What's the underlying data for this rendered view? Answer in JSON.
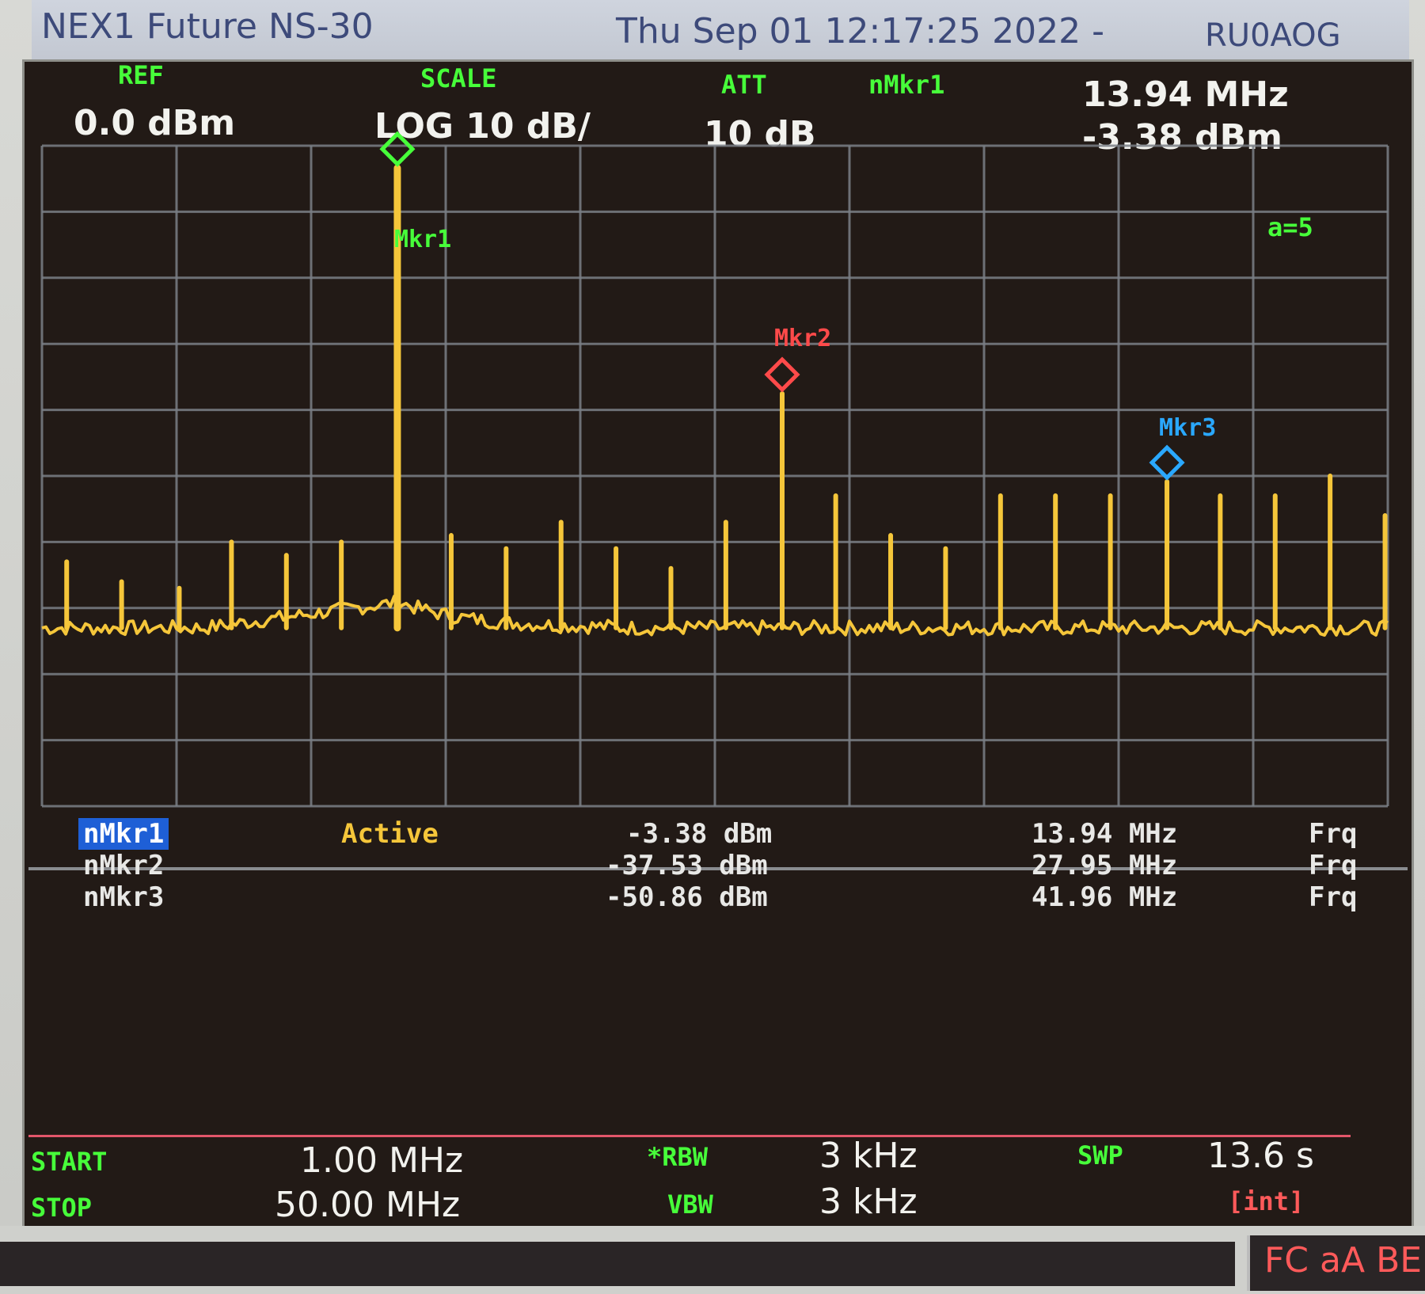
{
  "title_bar": {
    "device": "NEX1 Future NS-30",
    "datetime": "Thu Sep 01 12:17:25 2022 -",
    "callsign": "RU0AOG"
  },
  "header": {
    "ref_label": "REF",
    "ref_value": "0.0 dBm",
    "scale_label": "SCALE",
    "scale_value": "LOG 10 dB/",
    "att_label": "ATT",
    "att_value": "10 dB",
    "active_marker_label": "nMkr1",
    "active_marker_freq": "13.94 MHz",
    "active_marker_level": "-3.38 dBm",
    "avg_indicator": "a=5"
  },
  "markers_on_trace": [
    {
      "label": "Mkr1",
      "color": "#47ff3a"
    },
    {
      "label": "Mkr2",
      "color": "#ff4a4a"
    },
    {
      "label": "Mkr3",
      "color": "#2aa8ff"
    }
  ],
  "marker_table": [
    {
      "name": "nMkr1",
      "status": "Active",
      "level": "-3.38 dBm",
      "freq": "13.94 MHz",
      "mode": "Frq"
    },
    {
      "name": "nMkr2",
      "status": "",
      "level": "-37.53 dBm",
      "freq": "27.95 MHz",
      "mode": "Frq"
    },
    {
      "name": "nMkr3",
      "status": "",
      "level": "-50.86 dBm",
      "freq": "41.96 MHz",
      "mode": "Frq"
    }
  ],
  "footer": {
    "start_label": "START",
    "start_value": "1.00 MHz",
    "stop_label": "STOP",
    "stop_value": "50.00 MHz",
    "rbw_label": "*RBW",
    "rbw_value": "3 kHz",
    "vbw_label": "VBW",
    "vbw_value": "3 kHz",
    "swp_label": "SWP",
    "swp_value": "13.6 s",
    "swp_mode": "[int]"
  },
  "status_box": "FC aA BE",
  "colors": {
    "trace": "#f5c63a",
    "grid": "#7b7f86",
    "label_green": "#47ff3a",
    "mkr2": "#ff4a4a",
    "mkr3": "#2aa8ff",
    "background": "#221a16"
  },
  "chart_data": {
    "type": "line",
    "xlim": [
      1.0,
      50.0
    ],
    "ylim": [
      -100,
      0
    ],
    "noise_floor_dbm": -73,
    "peaks": [
      {
        "x": 13.94,
        "y": -3.38
      },
      {
        "x": 27.95,
        "y": -37.53
      },
      {
        "x": 41.96,
        "y": -50.86
      },
      {
        "x": 1.9,
        "y": -63
      },
      {
        "x": 3.9,
        "y": -66
      },
      {
        "x": 6.0,
        "y": -67
      },
      {
        "x": 7.9,
        "y": -60
      },
      {
        "x": 9.9,
        "y": -62
      },
      {
        "x": 11.9,
        "y": -60
      },
      {
        "x": 15.9,
        "y": -59
      },
      {
        "x": 17.9,
        "y": -61
      },
      {
        "x": 19.9,
        "y": -57
      },
      {
        "x": 21.9,
        "y": -61
      },
      {
        "x": 23.9,
        "y": -64
      },
      {
        "x": 25.9,
        "y": -57
      },
      {
        "x": 29.9,
        "y": -53
      },
      {
        "x": 31.9,
        "y": -59
      },
      {
        "x": 33.9,
        "y": -61
      },
      {
        "x": 35.9,
        "y": -53
      },
      {
        "x": 37.9,
        "y": -53
      },
      {
        "x": 39.9,
        "y": -53
      },
      {
        "x": 43.9,
        "y": -53
      },
      {
        "x": 45.9,
        "y": -53
      },
      {
        "x": 47.9,
        "y": -50
      },
      {
        "x": 49.9,
        "y": -56
      }
    ]
  }
}
